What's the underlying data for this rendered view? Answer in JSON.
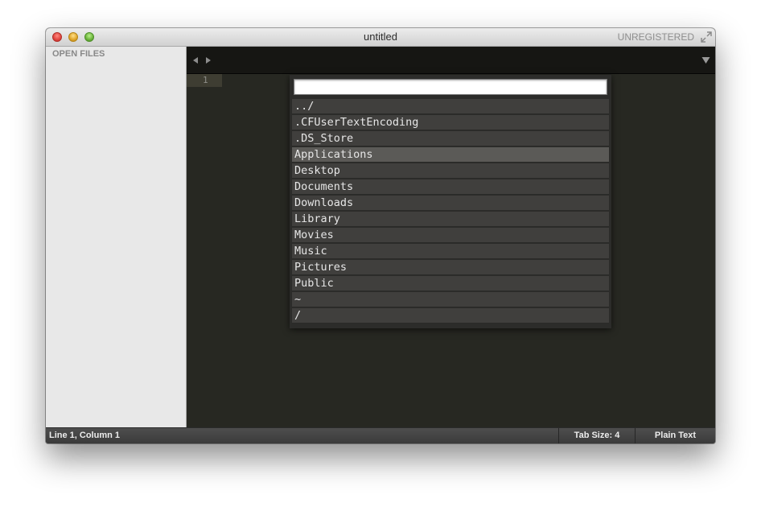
{
  "window": {
    "title": "untitled",
    "license_status": "UNREGISTERED"
  },
  "sidebar": {
    "heading": "OPEN FILES"
  },
  "editor": {
    "line_numbers": [
      "1"
    ]
  },
  "palette": {
    "input_value": "",
    "items": [
      {
        "label": "../",
        "selected": false
      },
      {
        "label": ".CFUserTextEncoding",
        "selected": false
      },
      {
        "label": ".DS_Store",
        "selected": false
      },
      {
        "label": "Applications",
        "selected": true
      },
      {
        "label": "Desktop",
        "selected": false
      },
      {
        "label": "Documents",
        "selected": false
      },
      {
        "label": "Downloads",
        "selected": false
      },
      {
        "label": "Library",
        "selected": false
      },
      {
        "label": "Movies",
        "selected": false
      },
      {
        "label": "Music",
        "selected": false
      },
      {
        "label": "Pictures",
        "selected": false
      },
      {
        "label": "Public",
        "selected": false
      },
      {
        "label": "~",
        "selected": false
      },
      {
        "label": "/",
        "selected": false
      }
    ]
  },
  "statusbar": {
    "position": "Line 1, Column 1",
    "tab_size": "Tab Size: 4",
    "syntax": "Plain Text"
  },
  "icons": {
    "close": "close-button",
    "minimize": "minimize-button",
    "zoom": "zoom-button",
    "fullscreen": "fullscreen-icon",
    "nav_back": "arrow-left-icon",
    "nav_forward": "arrow-right-icon",
    "tab_menu": "triangle-down-icon"
  },
  "colors": {
    "editor_bg": "#272822",
    "tabbar_bg": "#161613",
    "sidebar_bg": "#e8e8e8",
    "palette_item_bg": "#403f3d",
    "palette_item_selected_bg": "#5b5a57"
  }
}
